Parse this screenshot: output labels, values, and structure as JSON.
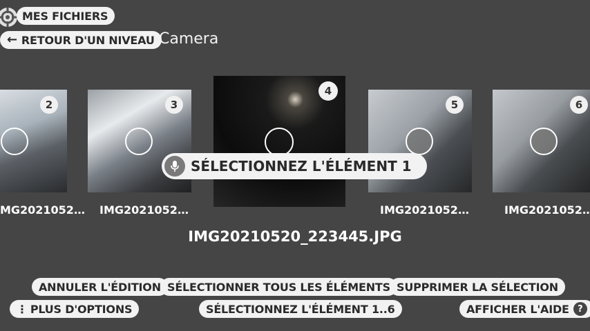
{
  "header": {
    "my_files_label": "MES FICHIERS",
    "back_label": "RETOUR D'UN NIVEAU",
    "folder_title": "Camera"
  },
  "thumbnails": [
    {
      "number": "2",
      "caption": "IMG2021052…",
      "selected": false
    },
    {
      "number": "3",
      "caption": "IMG2021052…",
      "selected": false
    },
    {
      "number": "4",
      "caption": "",
      "selected": false,
      "focused": true
    },
    {
      "number": "5",
      "caption": "IMG2021052…",
      "selected": true
    },
    {
      "number": "6",
      "caption": "IMG2021052…",
      "selected": true
    }
  ],
  "voice_hint": "SÉLECTIONNEZ L'ÉLÉMENT 1",
  "current_filename": "IMG20210520_223445.JPG",
  "actions": {
    "cancel_edit": "ANNULER L'ÉDITION",
    "select_all": "SÉLECTIONNER TOUS LES ÉLÉMENTS",
    "delete_selection": "SUPPRIMER LA SÉLECTION",
    "more_options": "PLUS D'OPTIONS",
    "select_range": "SÉLECTIONNEZ L'ÉLÉMENT 1..6",
    "show_help": "AFFICHER L'AIDE",
    "help_glyph": "?"
  }
}
